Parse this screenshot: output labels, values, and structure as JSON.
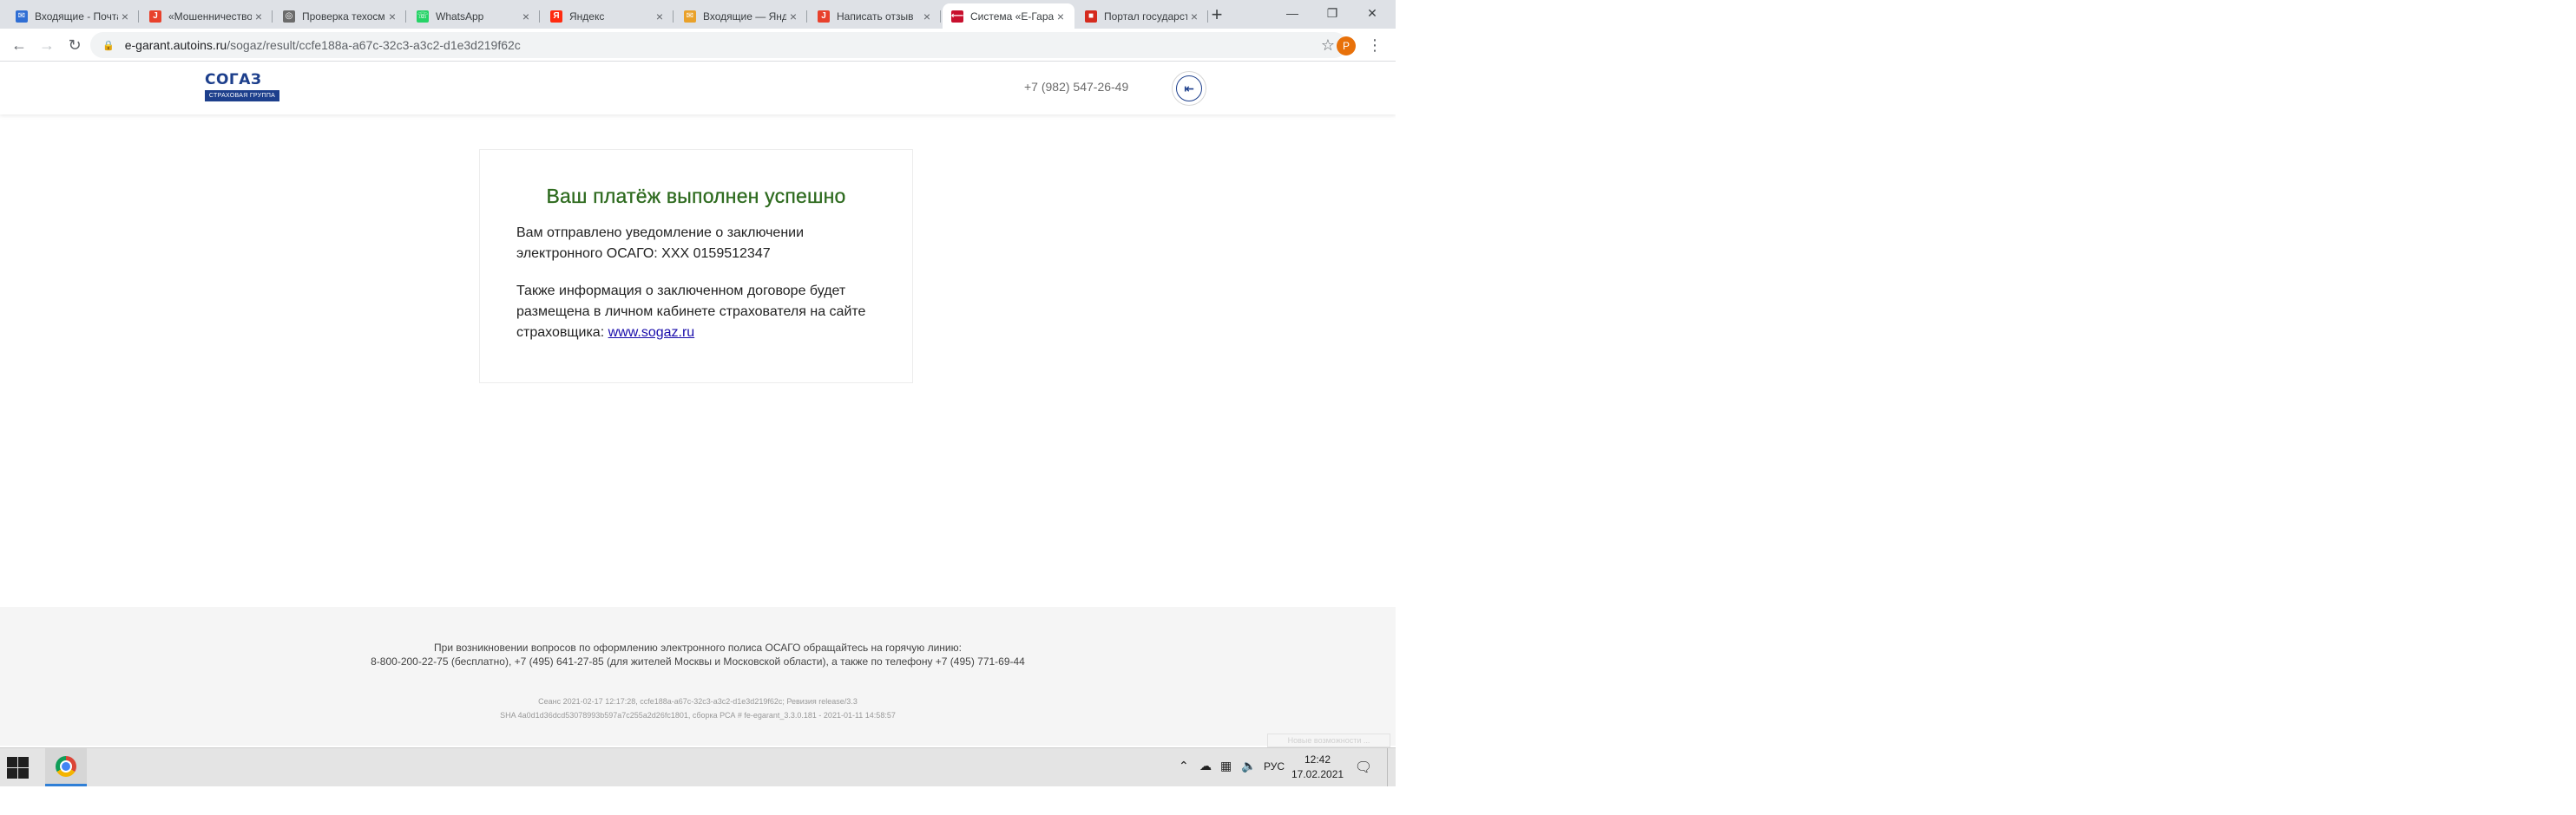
{
  "browser": {
    "tabs": [
      {
        "title": "Входящие - Почта",
        "favicon_color": "#2f6ed4",
        "favicon_glyph": "✉",
        "active": false
      },
      {
        "title": "«Мошенничество»",
        "favicon_color": "#e8412c",
        "favicon_glyph": "J",
        "active": false
      },
      {
        "title": "Проверка техосмотра",
        "favicon_color": "#6b6b6b",
        "favicon_glyph": "◎",
        "active": false
      },
      {
        "title": "WhatsApp",
        "favicon_color": "#25d366",
        "favicon_glyph": "☏",
        "active": false
      },
      {
        "title": "Яндекс",
        "favicon_color": "#ff2b10",
        "favicon_glyph": "Я",
        "active": false
      },
      {
        "title": "Входящие — Яндекс",
        "favicon_color": "#e9a12a",
        "favicon_glyph": "✉",
        "active": false
      },
      {
        "title": "Написать отзыв",
        "favicon_color": "#e8412c",
        "favicon_glyph": "J",
        "active": false
      },
      {
        "title": "Система «Е-Гарант»",
        "favicon_color": "#c8102e",
        "favicon_glyph": "⟵",
        "active": true
      },
      {
        "title": "Портал государственных",
        "favicon_color": "#d52b1e",
        "favicon_glyph": "■",
        "active": false
      }
    ],
    "new_tab_icon": "plus-icon",
    "window_controls": [
      "minimize-icon",
      "restore-icon",
      "close-icon"
    ],
    "url_host": "e-garant.autoins.ru",
    "url_path": "/sogaz/result/ccfe188a-a67c-32c3-a3c2-d1e3d219f62c",
    "profile_initial": "P"
  },
  "header": {
    "logo_top": "СОГАЗ",
    "logo_bottom": "СТРАХОВАЯ ГРУППА",
    "phone": "+7 (982) 547-26-49",
    "logout_icon": "logout-icon"
  },
  "card": {
    "title": "Ваш платёж выполнен успешно",
    "paragraph1": "Вам отправлено уведомление о заключении электронного ОСАГО: ХХХ 0159512347",
    "paragraph2_prefix": "Также информация о заключенном договоре будет размещена в личном кабинете страхователя на сайте страховщика: ",
    "link_text": "www.sogaz.ru",
    "title_color": "#2e6b1f"
  },
  "footer": {
    "line1": "При возникновении вопросов по оформлению электронного полиса ОСАГО обращайтесь на горячую линию:",
    "line2": "8-800-200-22-75 (бесплатно), +7 (495) 641-27-85 (для жителей Москвы и Московской области), а также по телефону +7 (495) 771-69-44",
    "meta1": "Сеанс 2021-02-17 12:17:28, ccfe188a-a67c-32c3-a3c2-d1e3d219f62c; Ревизия release/3.3",
    "meta2": "SHA 4a0d1d36dcd53078993b597a7c255a2d26fc1801, сборка РСА # fe-egarant_3.3.0.181 - 2021-01-11 14:58:57",
    "corner_text": "Новые возможности ..."
  },
  "taskbar": {
    "language": "РУС",
    "time": "12:42",
    "date": "17.02.2021"
  }
}
